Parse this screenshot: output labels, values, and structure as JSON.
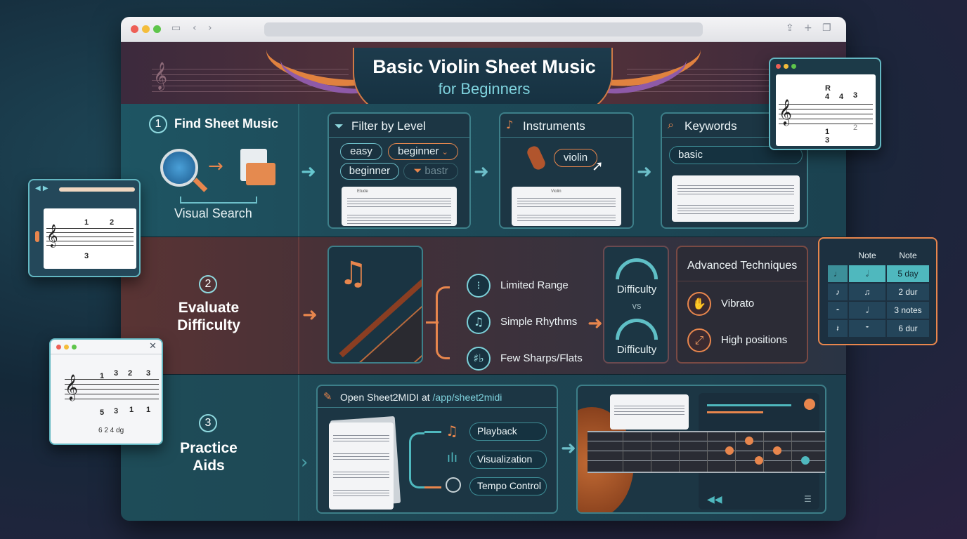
{
  "header": {
    "title": "Basic Violin Sheet Music",
    "subtitle": "for Beginners"
  },
  "step1": {
    "number": "1",
    "title": "Find Sheet Music",
    "visual_search_label": "Visual Search",
    "filter_panel": {
      "title": "Filter by Level",
      "pills": [
        "easy",
        "beginner",
        "beginner",
        "bastr"
      ],
      "sheet_label": "Etude"
    },
    "instruments_panel": {
      "title": "Instruments",
      "selected": "violin",
      "sheet_label": "Violin"
    },
    "keywords_panel": {
      "title": "Keywords",
      "query": "basic"
    }
  },
  "step2": {
    "number": "2",
    "title_line1": "Evaluate",
    "title_line2": "Difficulty",
    "criteria": [
      "Limited Range",
      "Simple Rhythms",
      "Few Sharps/Flats"
    ],
    "gauge_top_label": "Difficulty",
    "vs_label": "vs",
    "gauge_bottom_label": "Difficulty",
    "advanced": {
      "title": "Advanced Techniques",
      "items": [
        "Vibrato",
        "High positions"
      ]
    }
  },
  "step3": {
    "number": "3",
    "title_line1": "Practice",
    "title_line2": "Aids",
    "app_title": "Open Sheet2MIDI at",
    "app_path": "/app/sheet2midi",
    "features": [
      "Playback",
      "Visualization",
      "Tempo Control"
    ]
  },
  "note_table": {
    "headers": [
      "Note",
      "Note"
    ],
    "rows": [
      [
        "♩",
        "𝅗𝅥",
        "5 day"
      ],
      [
        "♪",
        "♫",
        "2 dur"
      ],
      [
        "𝄼",
        "𝅗𝅥",
        "3 notes"
      ],
      [
        "𝄽",
        "𝄻",
        "6 dur"
      ]
    ]
  },
  "floating_top_right": {
    "fingerings_top": [
      "R",
      "4",
      "4",
      "3"
    ],
    "fingerings_bottom": [
      "1",
      "3",
      "2"
    ]
  },
  "floating_left_top": {
    "fingerings_top": [
      "1",
      "2"
    ],
    "fingerings_bottom": [
      "3"
    ]
  },
  "floating_left_bottom": {
    "fingerings_top": [
      "1",
      "3",
      "2",
      "3"
    ],
    "fingerings_bottom": [
      "5",
      "3",
      "1",
      "1"
    ],
    "footer": "6 2 4   dg"
  },
  "colors": {
    "accent_teal": "#66c7cf",
    "accent_orange": "#e8864d",
    "background": "#142838"
  },
  "icons": [
    "magnifier-globe-icon",
    "folder-icon",
    "filter-icon",
    "guitar-icon",
    "search-icon",
    "violin-icon",
    "cursor-icon",
    "music-note-icon",
    "range-icon",
    "sharp-flat-icon",
    "gauge-icon",
    "hand-icon",
    "arrows-icon",
    "edit-icon",
    "waveform-icon",
    "clock-icon",
    "rewind-icon"
  ]
}
